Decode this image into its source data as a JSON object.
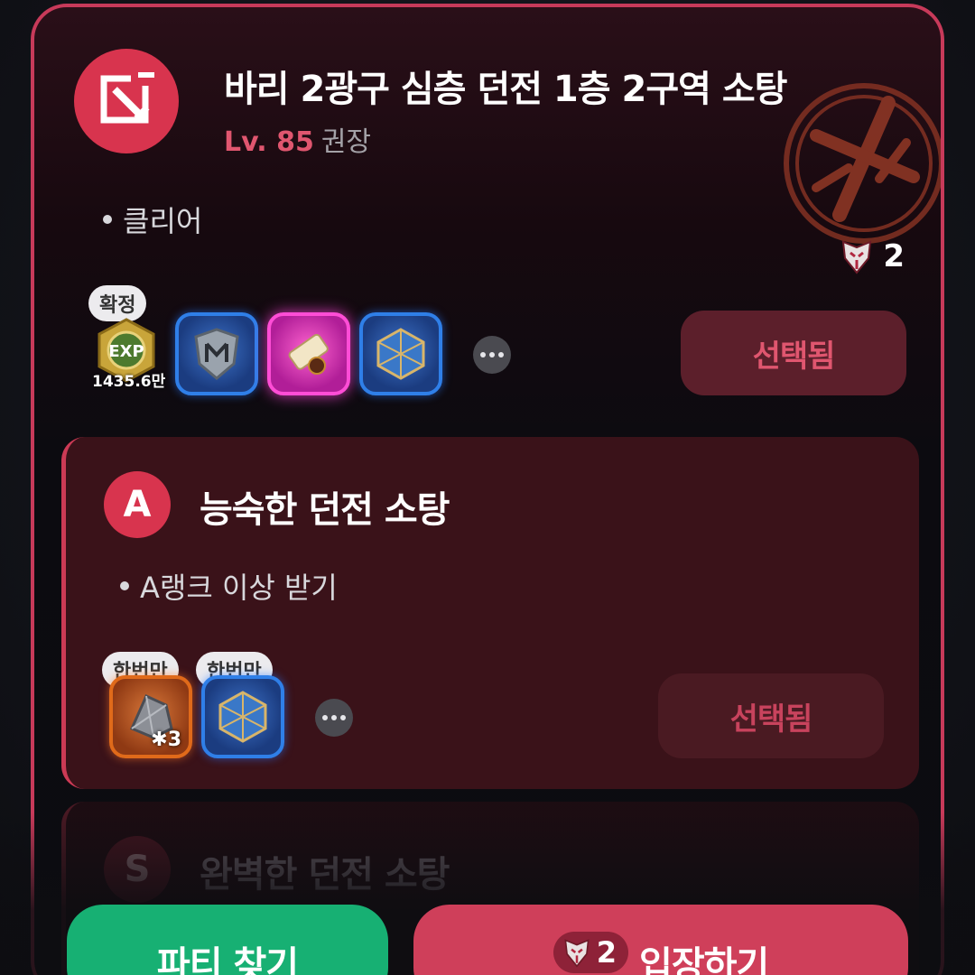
{
  "quest": {
    "title": "바리 2광구 심층 던전 1층 2구역 소탕",
    "level": "Lv. 85",
    "level_suffix": "권장",
    "objective": "클리어",
    "cost": "2",
    "items": [
      {
        "name": "exp-icon",
        "tag": "확정",
        "amount": "1435.6만"
      },
      {
        "name": "rune-stone-icon"
      },
      {
        "name": "scroll-icon"
      },
      {
        "name": "dice-icon"
      }
    ],
    "selected_label": "선택됨"
  },
  "sub_quest_a": {
    "rank": "A",
    "title": "능숙한 던전 소탕",
    "objective": "A랭크 이상 받기",
    "items": [
      {
        "name": "ore-icon",
        "tag": "한번만",
        "count": "3"
      },
      {
        "name": "dice-icon",
        "tag": "한번만"
      }
    ],
    "selected_label": "선택됨"
  },
  "sub_quest_s": {
    "rank": "S",
    "title": "완벽한 던전 소탕"
  },
  "buttons": {
    "party_label": "파티 찾기",
    "enter_label": "입장하기",
    "enter_cost": "2"
  },
  "colors": {
    "accent": "#cf3f5a",
    "party_green": "#17b073",
    "selected_text": "#e0566f"
  }
}
